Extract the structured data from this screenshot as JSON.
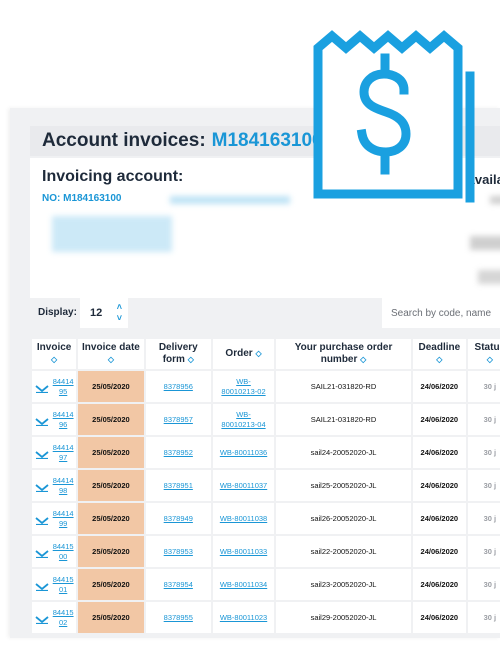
{
  "title": {
    "prefix": "Account invoices:",
    "account_code": "M184163100"
  },
  "invoicing": {
    "label": "Invoicing account:",
    "number": "NO: M184163100"
  },
  "right_label": "Availa",
  "display": {
    "label": "Display:",
    "value": "12"
  },
  "search": {
    "placeholder": "Search by code, name"
  },
  "columns": {
    "invoice": "Invoice",
    "invoice_date": "Invoice date",
    "delivery_form": "Delivery form",
    "order": "Order",
    "purchase_order": "Your purchase order number",
    "deadline": "Deadline",
    "status": "Status"
  },
  "rows": [
    {
      "invoice_a": "84414",
      "invoice_b": "95",
      "date": "25/05/2020",
      "delivery": "8378956",
      "order_a": "WB-",
      "order_b": "80010213-02",
      "po": "SAIL21-031820-RD",
      "deadline": "24/06/2020",
      "status": "30 j"
    },
    {
      "invoice_a": "84414",
      "invoice_b": "96",
      "date": "25/05/2020",
      "delivery": "8378957",
      "order_a": "WB-",
      "order_b": "80010213-04",
      "po": "SAIL21-031820-RD",
      "deadline": "24/06/2020",
      "status": "30 j"
    },
    {
      "invoice_a": "84414",
      "invoice_b": "97",
      "date": "25/05/2020",
      "delivery": "8378952",
      "order_a": "WB-80011036",
      "order_b": "",
      "po": "sail24-20052020-JL",
      "deadline": "24/06/2020",
      "status": "30 j"
    },
    {
      "invoice_a": "84414",
      "invoice_b": "98",
      "date": "25/05/2020",
      "delivery": "8378951",
      "order_a": "WB-80011037",
      "order_b": "",
      "po": "sail25-20052020-JL",
      "deadline": "24/06/2020",
      "status": "30 j"
    },
    {
      "invoice_a": "84414",
      "invoice_b": "99",
      "date": "25/05/2020",
      "delivery": "8378949",
      "order_a": "WB-80011038",
      "order_b": "",
      "po": "sail26-20052020-JL",
      "deadline": "24/06/2020",
      "status": "30 j"
    },
    {
      "invoice_a": "84415",
      "invoice_b": "00",
      "date": "25/05/2020",
      "delivery": "8378953",
      "order_a": "WB-80011033",
      "order_b": "",
      "po": "sail22-20052020-JL",
      "deadline": "24/06/2020",
      "status": "30 j"
    },
    {
      "invoice_a": "84415",
      "invoice_b": "01",
      "date": "25/05/2020",
      "delivery": "8378954",
      "order_a": "WB-80011034",
      "order_b": "",
      "po": "sail23-20052020-JL",
      "deadline": "24/06/2020",
      "status": "30 j"
    },
    {
      "invoice_a": "84415",
      "invoice_b": "02",
      "date": "25/05/2020",
      "delivery": "8378955",
      "order_a": "WB-80011023",
      "order_b": "",
      "po": "sail29-20052020-JL",
      "deadline": "24/06/2020",
      "status": "30 j"
    }
  ],
  "colors": {
    "accent": "#1a96d6",
    "date_cell": "#f2c7a5",
    "panel": "#f0f1f3"
  },
  "icons": {
    "hero": "receipt-dollar-icon",
    "row": "download-icon",
    "sort": "sort-icon",
    "stepper": "stepper-icon"
  }
}
